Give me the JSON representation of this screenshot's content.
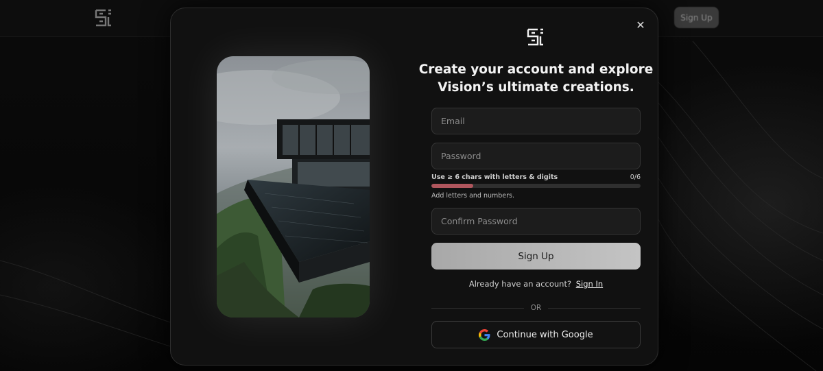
{
  "background": {
    "logo_icon": "brand-logo-icon",
    "signup_label": "Sign Up"
  },
  "modal": {
    "close_icon": "close-icon",
    "close_glyph": "✕",
    "logo_icon": "brand-logo-icon",
    "hero_image": "modern-cliffside-house-with-infinity-pool",
    "heading_line1": "Create your account and explore",
    "heading_line2": "Vision’s ultimate creations.",
    "email": {
      "value": "",
      "placeholder": "Email"
    },
    "password": {
      "value": "",
      "placeholder": "Password"
    },
    "password_rule": "Use ≥ 6 chars with letters & digits",
    "password_count": "0/6",
    "strength_fraction": 0.2,
    "strength_color": "#b0565d",
    "password_advice": "Add letters and numbers.",
    "confirm_password": {
      "value": "",
      "placeholder": "Confirm Password"
    },
    "signup_label": "Sign Up",
    "have_account_text": "Already have an account?",
    "signin_label": "Sign In",
    "or_label": "OR",
    "google_label": "Continue with Google",
    "google_icon": "google-g-icon"
  }
}
